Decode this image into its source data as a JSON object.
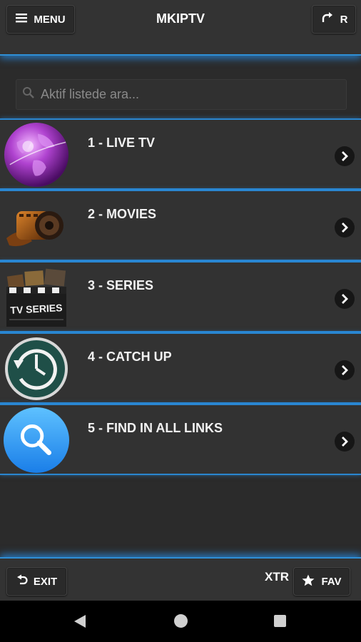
{
  "header": {
    "menu_label": "MENU",
    "title": "MKIPTV",
    "refresh_label": "R"
  },
  "search": {
    "placeholder": "Aktif listede ara..."
  },
  "list": {
    "items": [
      {
        "label": "1 - LIVE TV",
        "icon": "globe-icon"
      },
      {
        "label": "2 - MOVIES",
        "icon": "film-reel-icon"
      },
      {
        "label": "3 - SERIES",
        "icon": "tv-series-clapperboard-icon",
        "icon_text": "TV SERIES"
      },
      {
        "label": "4 - CATCH UP",
        "icon": "clock-history-icon"
      },
      {
        "label": "5 - FIND IN ALL LINKS",
        "icon": "magnifier-icon"
      }
    ]
  },
  "footer": {
    "exit_label": "EXIT",
    "xtr_label": "XTR",
    "fav_label": "FAV"
  },
  "colors": {
    "accent_glow": "#2f8fd6",
    "bar_bg": "#333333",
    "page_bg": "#2b2b2b"
  }
}
